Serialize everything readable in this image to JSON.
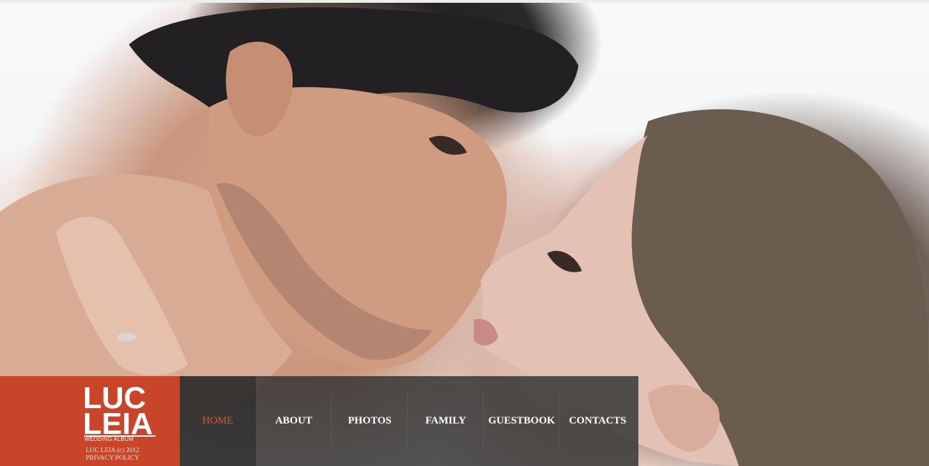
{
  "brand": {
    "title": "LUC\nLEIA",
    "subtitle": "WEDDING ALBUM",
    "accent_color": "#c8452a"
  },
  "footer": {
    "copyright": "LUC LEIA (c) 2012",
    "privacy": "PRIVACY POLICY"
  },
  "nav": {
    "items": [
      {
        "label": "HOME",
        "active": true
      },
      {
        "label": "ABOUT",
        "active": false
      },
      {
        "label": "PHOTOS",
        "active": false
      },
      {
        "label": "FAMILY",
        "active": false
      },
      {
        "label": "GUESTBOOK",
        "active": false
      },
      {
        "label": "CONTACTS",
        "active": false
      }
    ],
    "active_color": "#d35a3b"
  },
  "hero": {
    "image": "couple-photo"
  }
}
